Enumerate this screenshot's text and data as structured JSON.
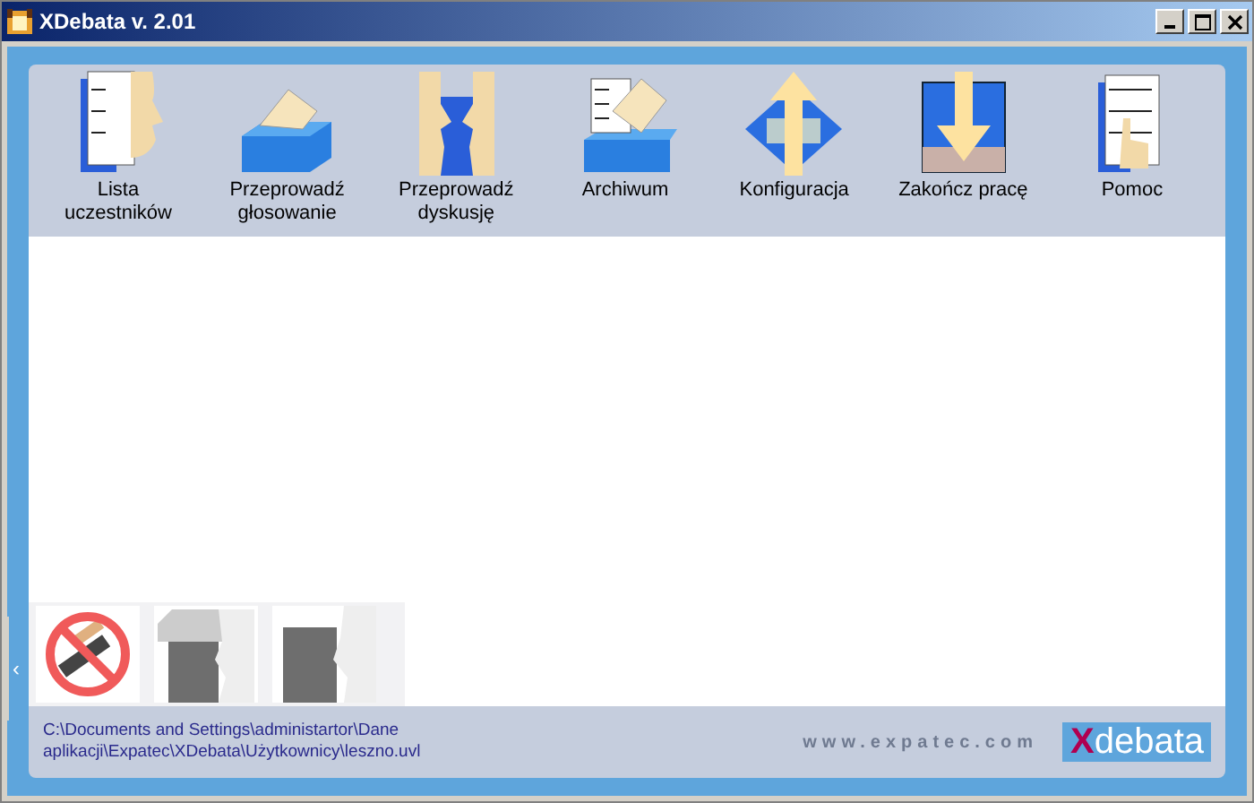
{
  "window": {
    "title": "XDebata v. 2.01",
    "controls": [
      {
        "kind": "minimize"
      },
      {
        "kind": "maximize"
      },
      {
        "kind": "close"
      }
    ]
  },
  "toolbar": [
    {
      "kind": "list",
      "label": "Lista uczestników"
    },
    {
      "kind": "ballot",
      "label": "Przeprowadź głosowanie"
    },
    {
      "kind": "faces",
      "label": "Przeprowadź dyskusję"
    },
    {
      "kind": "archive",
      "label": "Archiwum"
    },
    {
      "kind": "config",
      "label": "Konfiguracja"
    },
    {
      "kind": "exit",
      "label": "Zakończ pracę"
    },
    {
      "kind": "help",
      "label": "Pomoc"
    }
  ],
  "side_tab": "‹",
  "thumbnails": [
    {
      "kind": "no-phone"
    },
    {
      "kind": "speaker"
    },
    {
      "kind": "face"
    }
  ],
  "status": {
    "path": "C:\\Documents and Settings\\administartor\\Dane aplikacji\\Expatec\\XDebata\\Użytkownicy\\leszno.uvl",
    "website": "www.expatec.com",
    "logo": {
      "mark": "X",
      "text": "debata"
    }
  }
}
